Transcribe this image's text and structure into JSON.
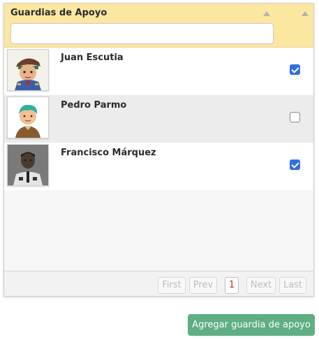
{
  "panel": {
    "title": "Guardias de Apoyo",
    "filter": {
      "value": "",
      "placeholder": ""
    }
  },
  "rows": [
    {
      "name": "Juan Escutia",
      "avatar": "cadet-cartoon-avatar",
      "checked": true
    },
    {
      "name": "Pedro Parmo",
      "avatar": "boy-cartoon-avatar",
      "checked": false
    },
    {
      "name": "Francisco Márquez",
      "avatar": "guard-photo-avatar",
      "checked": true
    }
  ],
  "pagination": {
    "first": "First",
    "prev": "Prev",
    "page": "1",
    "next": "Next",
    "last": "Last"
  },
  "actions": {
    "add_label": "Agregar guardia de apoyo"
  },
  "colors": {
    "header": "#fce7a1",
    "checkbox_on": "#2f6fe0",
    "add_button": "#5fae84",
    "current_page": "#c62828"
  }
}
